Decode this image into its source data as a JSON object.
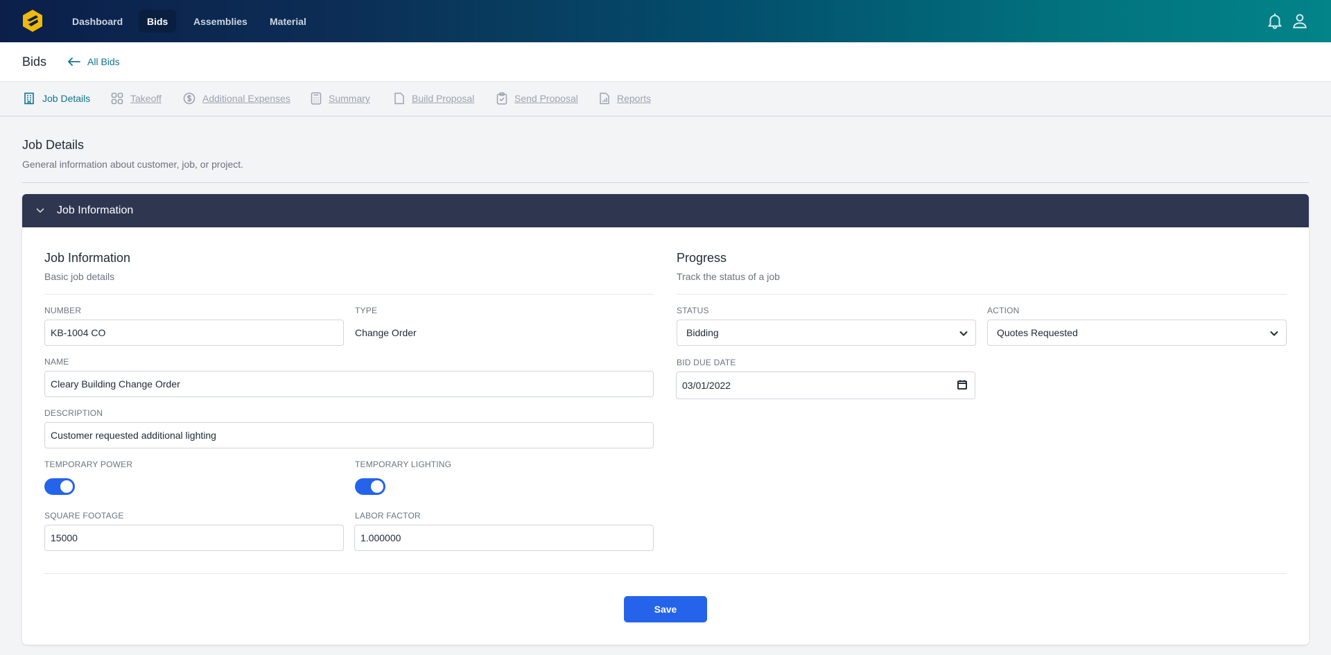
{
  "nav": {
    "items": [
      {
        "label": "Dashboard",
        "active": false
      },
      {
        "label": "Bids",
        "active": true
      },
      {
        "label": "Assemblies",
        "active": false
      },
      {
        "label": "Material",
        "active": false
      }
    ],
    "icons": [
      "bell-icon",
      "user-icon"
    ]
  },
  "subheader": {
    "title": "Bids",
    "back_label": "All Bids"
  },
  "tabs": [
    {
      "label": "Job Details",
      "icon": "building-icon",
      "active": true
    },
    {
      "label": "Takeoff",
      "icon": "grid-icon",
      "active": false
    },
    {
      "label": "Additional Expenses",
      "icon": "dollar-circle-icon",
      "active": false
    },
    {
      "label": "Summary",
      "icon": "calculator-icon",
      "active": false
    },
    {
      "label": "Build Proposal",
      "icon": "document-icon",
      "active": false
    },
    {
      "label": "Send Proposal",
      "icon": "clipboard-check-icon",
      "active": false
    },
    {
      "label": "Reports",
      "icon": "report-chart-icon",
      "active": false
    }
  ],
  "page": {
    "title": "Job Details",
    "description": "General information about customer, job, or project."
  },
  "card": {
    "header": "Job Information",
    "job_info": {
      "title": "Job Information",
      "description": "Basic job details",
      "number_label": "NUMBER",
      "number_value": "KB-1004 CO",
      "type_label": "TYPE",
      "type_value": "Change Order",
      "name_label": "NAME",
      "name_value": "Cleary Building Change Order",
      "description_label": "DESCRIPTION",
      "description_value": "Customer requested additional lighting",
      "temp_power_label": "TEMPORARY POWER",
      "temp_power_on": true,
      "temp_lighting_label": "TEMPORARY LIGHTING",
      "temp_lighting_on": true,
      "sqft_label": "SQUARE FOOTAGE",
      "sqft_value": "15000",
      "labor_label": "LABOR FACTOR",
      "labor_value": "1.000000"
    },
    "progress": {
      "title": "Progress",
      "description": "Track the status of a job",
      "status_label": "STATUS",
      "status_value": "Bidding",
      "action_label": "ACTION",
      "action_value": "Quotes Requested",
      "due_label": "BID DUE DATE",
      "due_value": "03/01/2022"
    },
    "save_label": "Save"
  },
  "colors": {
    "primary": "#2563eb",
    "accent": "#0e7490",
    "card_header": "#2e3650",
    "logo": "#f0b90b"
  }
}
